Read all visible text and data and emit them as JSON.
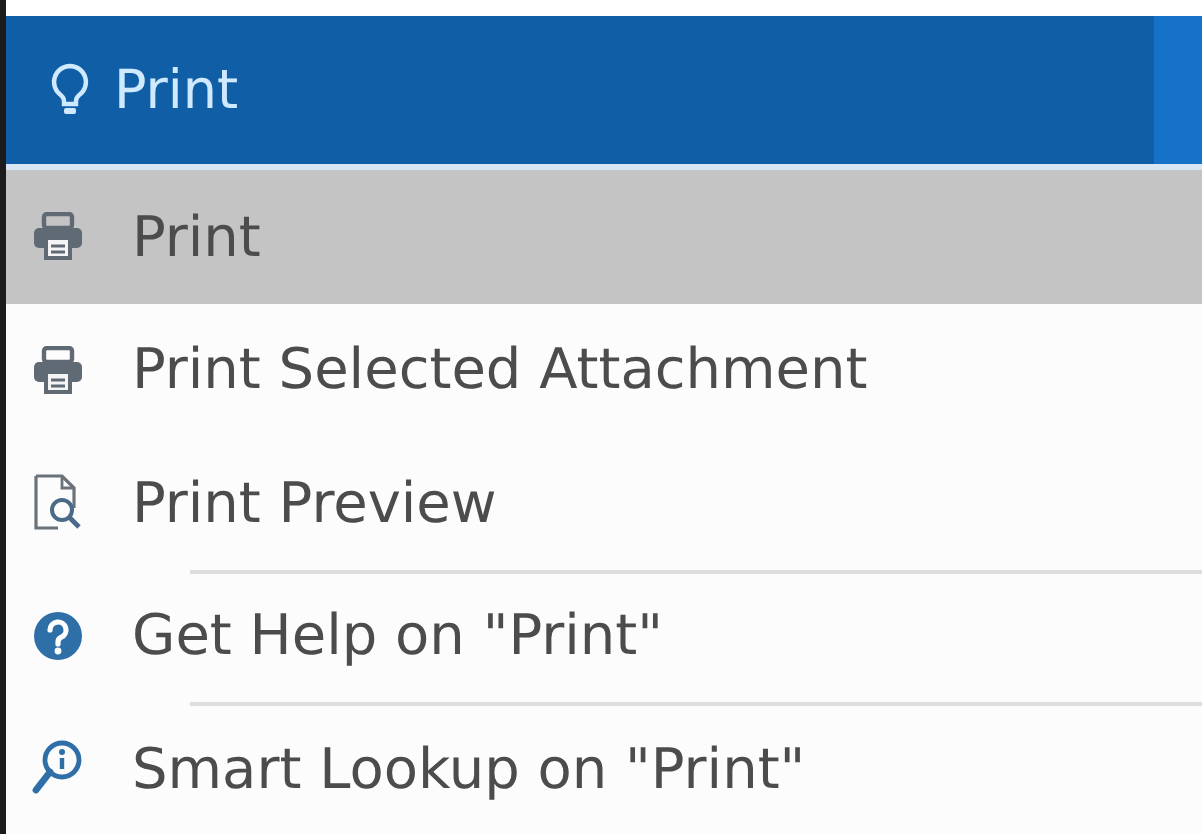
{
  "search": {
    "value": "Print"
  },
  "items": [
    {
      "label": "Print",
      "kind": "printer",
      "selected": true,
      "separated": false
    },
    {
      "label": "Print Selected Attachment",
      "kind": "printer",
      "selected": false,
      "separated": false
    },
    {
      "label": "Print Preview",
      "kind": "preview",
      "selected": false,
      "separated": false
    },
    {
      "label": "Get Help on \"Print\"",
      "kind": "help",
      "selected": false,
      "separated": true
    },
    {
      "label": "Smart Lookup on \"Print\"",
      "kind": "lookup",
      "selected": false,
      "separated": true
    }
  ]
}
